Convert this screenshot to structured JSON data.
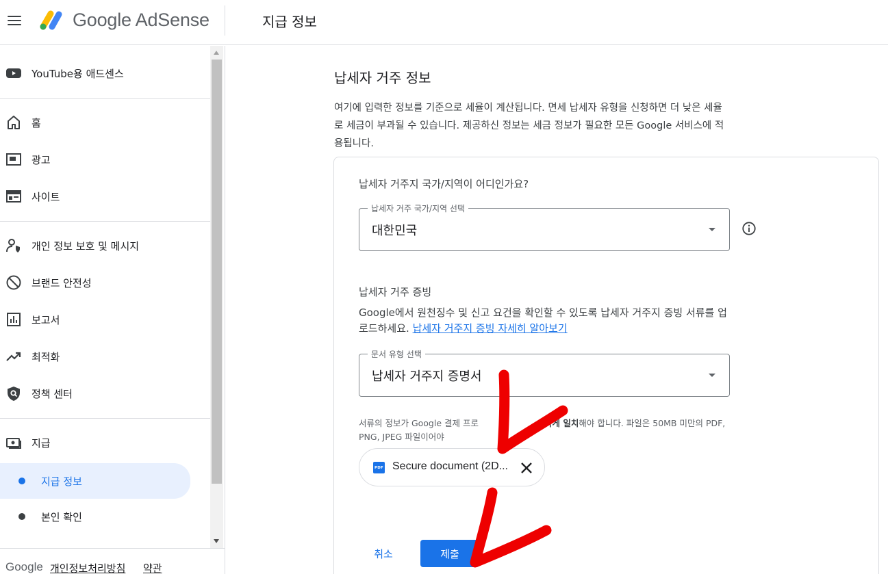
{
  "header": {
    "brand": "Google AdSense",
    "page_title": "지급 정보"
  },
  "sidebar": {
    "items": [
      {
        "id": "youtube",
        "label": "YouTube용 애드센스"
      },
      {
        "id": "home",
        "label": "홈"
      },
      {
        "id": "ads",
        "label": "광고"
      },
      {
        "id": "sites",
        "label": "사이트"
      },
      {
        "id": "privacy",
        "label": "개인 정보 보호 및 메시지"
      },
      {
        "id": "brand-safety",
        "label": "브랜드 안전성"
      },
      {
        "id": "reports",
        "label": "보고서"
      },
      {
        "id": "optimization",
        "label": "최적화"
      },
      {
        "id": "policy",
        "label": "정책 센터"
      },
      {
        "id": "payments",
        "label": "지급"
      },
      {
        "id": "payment-info",
        "label": "지급 정보"
      },
      {
        "id": "verification",
        "label": "본인 확인"
      }
    ],
    "footer": {
      "brand": "Google",
      "privacy": "개인정보처리방침",
      "terms": "약관"
    }
  },
  "main": {
    "title": "납세자 거주 정보",
    "description": "여기에 입력한 정보를 기준으로 세율이 계산됩니다. 면세 납세자 유형을 신청하면 더 낮은 세율로 세금이 부과될 수 있습니다. 제공하신 정보는 세금 정보가 필요한 모든 Google 서비스에 적용됩니다.",
    "country_question": "납세자 거주지 국가/지역이 어디인가요?",
    "country_select": {
      "label": "납세자 거주 국가/지역 선택",
      "value": "대한민국"
    },
    "proof_title": "납세자 거주 증빙",
    "proof_desc": "Google에서 원천징수 및 신고 요건을 확인할 수 있도록 납세자 거주지 증빙 서류를 업로드하세요.",
    "proof_link": "납세자 거주지 증빙 자세히 알아보기",
    "doc_select": {
      "label": "문서 유형 선택",
      "value": "납세자 거주지 증명서"
    },
    "hint_pre": "서류의 정보가 Google 결제 프로",
    "hint_bold": "하게 일치",
    "hint_post": "해야 합니다. 파일은 50MB 미만의 PDF, PNG, JPEG 파일이어야",
    "chip": {
      "file_type": "PDF",
      "name": "Secure document (2D..."
    },
    "cancel": "취소",
    "submit": "제출"
  },
  "colors": {
    "accent": "#1a73e8",
    "active_bg": "#e8f0fe",
    "annotation": "#ee0000"
  }
}
